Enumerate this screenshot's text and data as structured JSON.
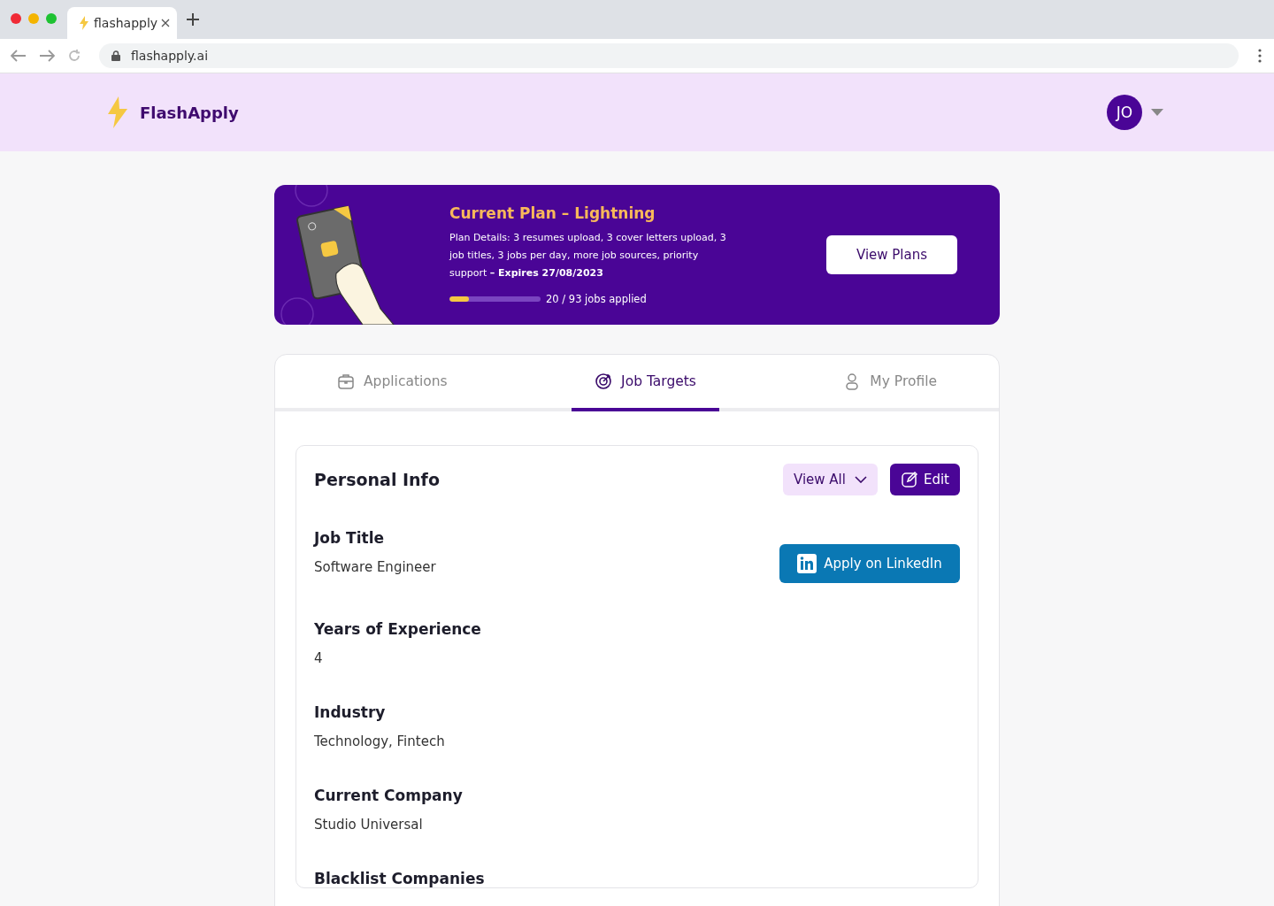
{
  "browser": {
    "tab_title": "flashapply",
    "url": "flashapply.ai"
  },
  "header": {
    "brand": "FlashApply",
    "avatar_initials": "JO"
  },
  "plan": {
    "title": "Current Plan – Lightning",
    "details": "Plan Details: 3 resumes upload, 3 cover letters upload, 3 job titles, 3 jobs per day, more job sources, priority support **– Expires 27/08/2023**",
    "progress": {
      "level": 0.215,
      "label": "20 / 93 jobs applied"
    },
    "button": "View Plans"
  },
  "tabs": [
    {
      "label": "Applications",
      "kind": "briefcase",
      "selected": false
    },
    {
      "label": "Job Targets",
      "kind": "target",
      "selected": true
    },
    {
      "label": "My Profile",
      "kind": "person",
      "selected": false
    }
  ],
  "section": {
    "title": "Personal Info",
    "view_all": "View All",
    "edit": "Edit",
    "apply_button": "Apply on LinkedIn",
    "fields": [
      {
        "label": "Job Title",
        "value": "Software Engineer"
      },
      {
        "label": "Years of Experience",
        "value": "4"
      },
      {
        "label": "Industry",
        "value": "Technology, Fintech"
      },
      {
        "label": "Current Company",
        "value": "Studio Universal"
      },
      {
        "label": "Blacklist Companies"
      }
    ]
  }
}
